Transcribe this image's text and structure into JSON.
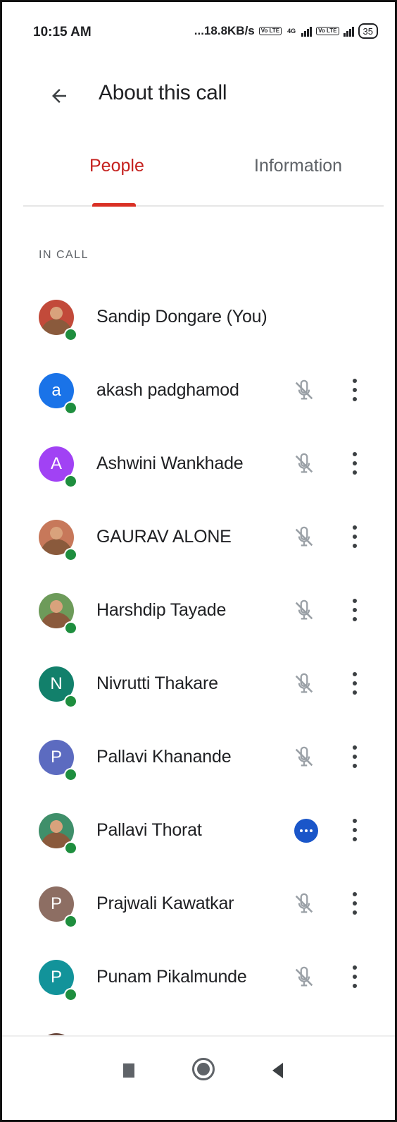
{
  "status_bar": {
    "time": "10:15 AM",
    "network_speed": "...18.8KB/s",
    "chip_1": "Vo LTE",
    "chip_2": "4G",
    "chip_3": "Vo LTE",
    "battery": "35"
  },
  "header": {
    "back_icon": "arrow-left-icon",
    "title": "About this call"
  },
  "tabs": [
    {
      "label": "People",
      "active": true
    },
    {
      "label": "Information",
      "active": false
    }
  ],
  "colors": {
    "accent": "#d93025",
    "presence": "#1e8e3e",
    "speaking": "#1a56c9"
  },
  "section_label": "IN CALL",
  "participants": [
    {
      "name": "Sandip Dongare (You)",
      "initial": "",
      "avatar_color": "#c24a3a",
      "photo": true,
      "mic": "none"
    },
    {
      "name": "akash padghamod",
      "initial": "a",
      "avatar_color": "#1a73e8",
      "photo": false,
      "mic": "muted"
    },
    {
      "name": "Ashwini Wankhade",
      "initial": "A",
      "avatar_color": "#a142f4",
      "photo": false,
      "mic": "muted"
    },
    {
      "name": "GAURAV ALONE",
      "initial": "",
      "avatar_color": "#c7785a",
      "photo": true,
      "mic": "muted"
    },
    {
      "name": "Harshdip Tayade",
      "initial": "",
      "avatar_color": "#6d9b5a",
      "photo": true,
      "mic": "muted"
    },
    {
      "name": "Nivrutti Thakare",
      "initial": "N",
      "avatar_color": "#12806b",
      "photo": false,
      "mic": "muted"
    },
    {
      "name": "Pallavi Khanande",
      "initial": "P",
      "avatar_color": "#5c6bc0",
      "photo": false,
      "mic": "muted"
    },
    {
      "name": "Pallavi Thorat",
      "initial": "",
      "avatar_color": "#3f8f6a",
      "photo": true,
      "mic": "speaking"
    },
    {
      "name": "Prajwali Kawatkar",
      "initial": "P",
      "avatar_color": "#8d6e63",
      "photo": false,
      "mic": "muted"
    },
    {
      "name": "Punam Pikalmunde",
      "initial": "P",
      "avatar_color": "#12939a",
      "photo": false,
      "mic": "muted"
    },
    {
      "name": "",
      "initial": "",
      "avatar_color": "#6d4c41",
      "photo": true,
      "mic": "muted"
    }
  ],
  "nav": {
    "recent_icon": "recent-apps-icon",
    "home_icon": "home-icon",
    "back_icon": "back-triangle-icon"
  }
}
